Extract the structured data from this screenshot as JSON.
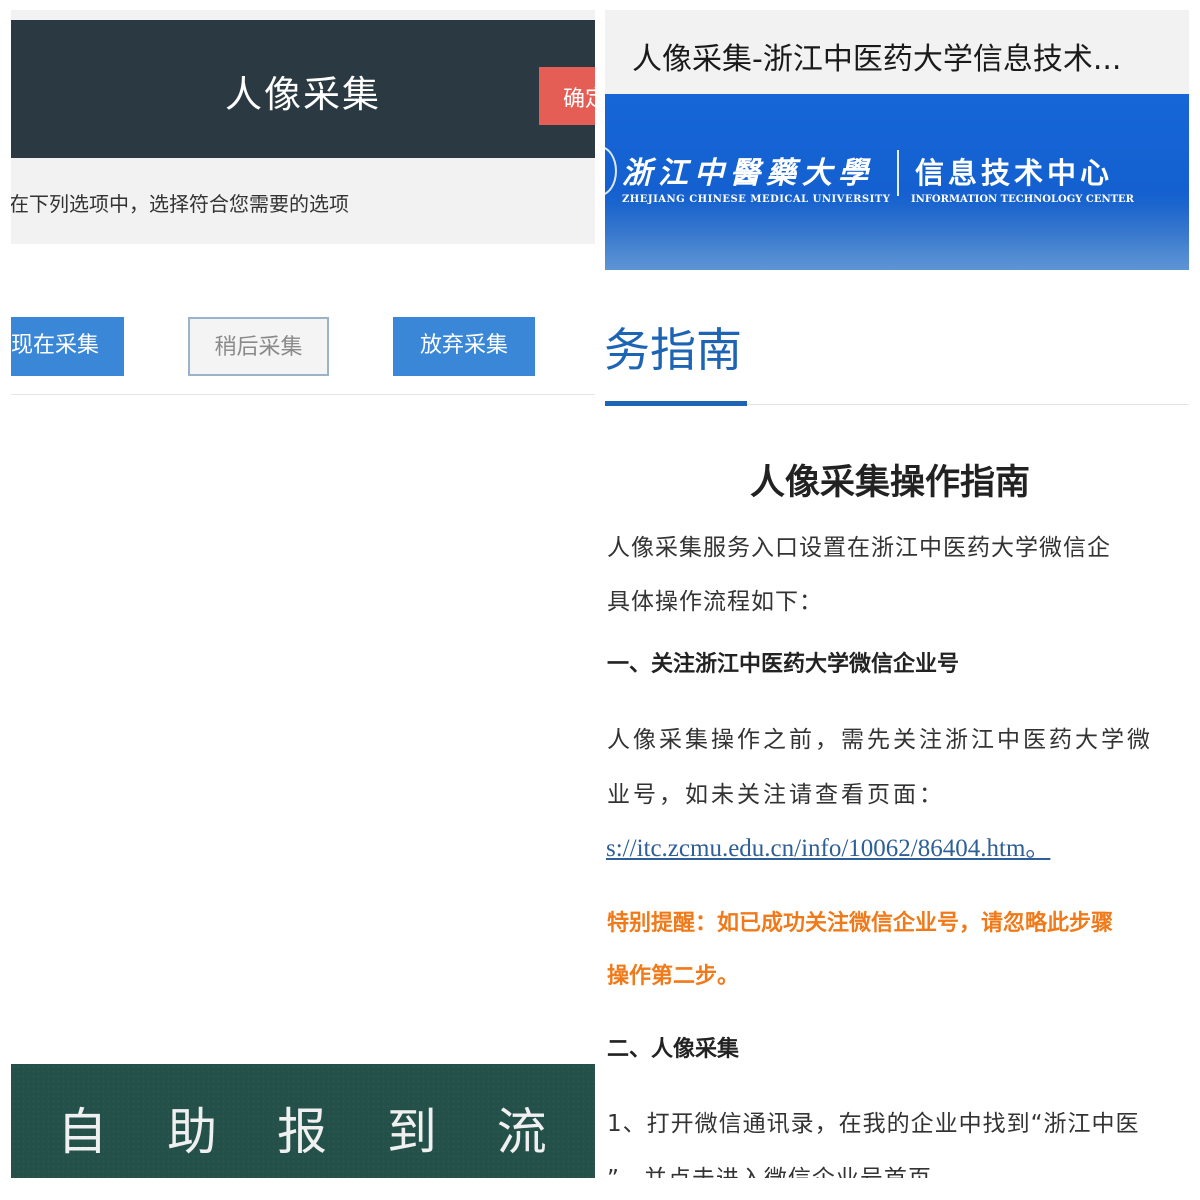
{
  "left_panel": {
    "dialog": {
      "title": "人像采集",
      "confirm_label": "确定",
      "prompt": "在下列选项中，选择符合您需要的选项"
    },
    "options": [
      {
        "label": "现在采集"
      },
      {
        "label": "稍后采集"
      },
      {
        "label": "放弃采集"
      }
    ],
    "footer_banner": "自 助 报 到 流 程"
  },
  "right_panel": {
    "page_title": "人像采集-浙江中医药大学信息技术...",
    "banner": {
      "university_cn": "浙江中醫藥大學",
      "university_en": "ZHEJIANG CHINESE MEDICAL UNIVERSITY",
      "center_cn": "信息技术中心",
      "center_en": "INFORMATION TECHNOLOGY CENTER"
    },
    "section_heading": "务指南",
    "article": {
      "title": "人像采集操作指南",
      "intro_line1": "人像采集服务入口设置在浙江中医药大学微信企",
      "intro_line2": "具体操作流程如下：",
      "step1_heading": "一、关注浙江中医药大学微信企业号",
      "step1_line1": "人像采集操作之前，需先关注浙江中医药大学微",
      "step1_line2": "业号，如未关注请查看页面：",
      "step1_link": "s://itc.zcmu.edu.cn/info/10062/86404.htm。",
      "notice_line1": "特别提醒：如已成功关注微信企业号，请忽略此步骤",
      "notice_line2": "操作第二步。",
      "step2_heading": "二、人像采集",
      "step2_line1": "1、打开微信通讯录，在我的企业中找到“浙江中医",
      "step2_line2": "”，并点击进入微信企业号首页。"
    }
  },
  "colors": {
    "dialog_header": "#2b3942",
    "confirm_button": "#e55e55",
    "primary_button": "#3a87d8",
    "banner_blue": "#1666d8",
    "heading_blue": "#1d64b5",
    "notice_orange": "#f07a1a",
    "footer_green": "#24504a"
  }
}
